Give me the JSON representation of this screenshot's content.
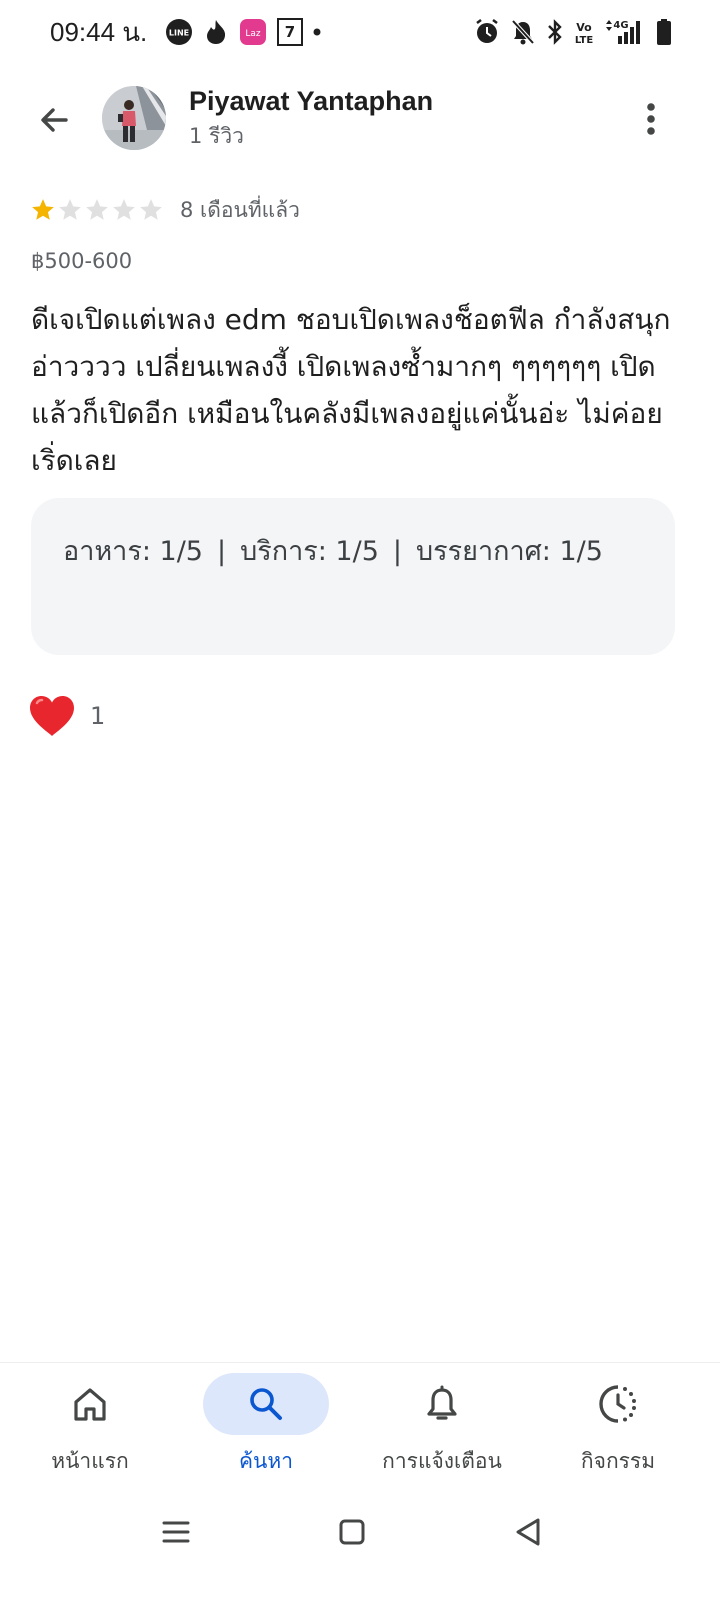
{
  "status_bar": {
    "time": "09:44 น.",
    "left_icons": [
      "line-app-icon",
      "tinder-app-icon",
      "lazada-app-icon",
      "seven-eleven-app-icon",
      "dot-indicator"
    ],
    "right_icons": [
      "alarm-icon",
      "mute-bell-icon",
      "bluetooth-icon",
      "volte-icon",
      "network-4g-signal-icon",
      "battery-icon"
    ]
  },
  "header": {
    "reviewer_name": "Piyawat Yantaphan",
    "review_count": "1 รีวิว"
  },
  "review": {
    "rating": 1,
    "max_rating": 5,
    "time_ago": "8 เดือนที่แล้ว",
    "price": "฿500-600",
    "text": "ดีเจเปิดแต่เพลง edm ชอบเปิดเพลงช็อตฟีล กำลังสนุก อ่าวววว เปลี่ยนเพลงงี้ เปิดเพลงซ้ำมากๆ ๆๆๆๆๆๆ เปิดแล้วก็เปิดอีก เหมือนในคลังมีเพลงอยู่แค่นั้นอ่ะ ไม่ค่อยเริ่ดเลย",
    "scores": {
      "food": "อาหาร: 1/5",
      "service": "บริการ: 1/5",
      "atmosphere": "บรรยากาศ: 1/5",
      "separator": "|"
    },
    "reaction_emoji": "❤️",
    "reaction_count": "1"
  },
  "colors": {
    "star_filled": "#f5b400",
    "star_empty": "#e0e0e0",
    "active_nav_bg": "#dde7fb",
    "active_nav_text": "#0b57d0",
    "card_bg": "#f4f5f7"
  },
  "bottom_nav": {
    "items": [
      {
        "label": "หน้าแรก",
        "icon": "home-icon",
        "active": false
      },
      {
        "label": "ค้นหา",
        "icon": "search-icon",
        "active": true
      },
      {
        "label": "การแจ้งเตือน",
        "icon": "bell-icon",
        "active": false
      },
      {
        "label": "กิจกรรม",
        "icon": "activity-icon",
        "active": false
      }
    ]
  }
}
